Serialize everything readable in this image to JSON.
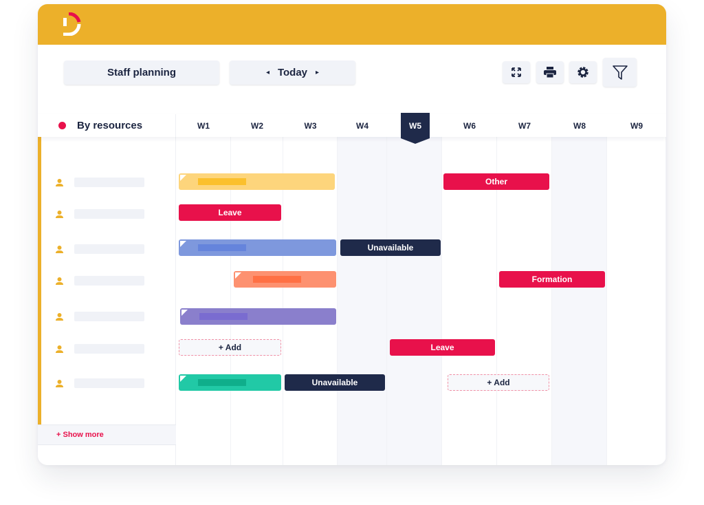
{
  "header": {
    "logo_icon": "brand-d-logo-icon",
    "colors": {
      "brand": "#ecb02a",
      "accent": "#e8114b",
      "dark": "#1f2a4a"
    }
  },
  "toolbar": {
    "view_label": "Staff planning",
    "today_label": "Today",
    "prev_icon": "◂",
    "next_icon": "▸",
    "icons": [
      "expand-icon",
      "print-icon",
      "gear-icon",
      "filter-icon"
    ]
  },
  "planning": {
    "group_label": "By resources",
    "weeks": [
      "W1",
      "W2",
      "W3",
      "W4",
      "W5",
      "W6",
      "W7",
      "W8",
      "W9"
    ],
    "current_week": "W5",
    "show_more_label": "+ Show more",
    "resources": [
      {
        "name": ""
      },
      {
        "name": ""
      },
      {
        "name": ""
      },
      {
        "name": ""
      },
      {
        "name": ""
      },
      {
        "name": ""
      },
      {
        "name": ""
      }
    ],
    "events": [
      {
        "row": 0,
        "type": "project",
        "label": "",
        "color": "#fdd57c",
        "inner": "#fbc02d"
      },
      {
        "row": 0,
        "type": "absence",
        "label": "Other",
        "color": "#e8114b"
      },
      {
        "row": 1,
        "type": "absence",
        "label": "Leave",
        "color": "#e8114b"
      },
      {
        "row": 2,
        "type": "project",
        "label": "",
        "color": "#7e98dd",
        "inner": "#6584dc"
      },
      {
        "row": 2,
        "type": "absence",
        "label": "Unavailable",
        "color": "#1f2a4a"
      },
      {
        "row": 3,
        "type": "project",
        "label": "",
        "color": "#fd9170",
        "inner": "#ff7044"
      },
      {
        "row": 3,
        "type": "absence",
        "label": "Formation",
        "color": "#e8114b"
      },
      {
        "row": 4,
        "type": "project",
        "label": "",
        "color": "#8a7fcc",
        "inner": "#7a6cd0"
      },
      {
        "row": 5,
        "type": "add",
        "label": "+ Add"
      },
      {
        "row": 5,
        "type": "absence",
        "label": "Leave",
        "color": "#e8114b"
      },
      {
        "row": 6,
        "type": "project",
        "label": "",
        "color": "#21c9a6",
        "inner": "#0fae8b"
      },
      {
        "row": 6,
        "type": "absence",
        "label": "Unavailable",
        "color": "#1f2a4a"
      },
      {
        "row": 6,
        "type": "add",
        "label": "+ Add"
      }
    ]
  }
}
